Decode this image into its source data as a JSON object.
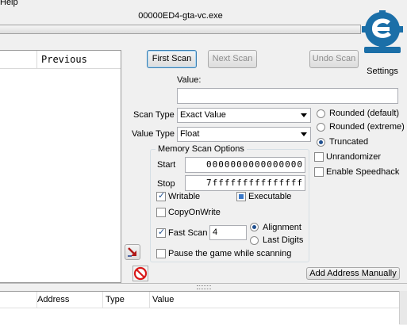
{
  "menu": {
    "help": "Help"
  },
  "process_title": "00000ED4-gta-vc.exe",
  "logo": {
    "icon": "cheat-engine-logo",
    "text": "Cheat Engine"
  },
  "settings_label": "Settings",
  "results": {
    "previous_header": "Previous"
  },
  "buttons": {
    "first_scan": "First Scan",
    "next_scan": "Next Scan",
    "undo_scan": "Undo Scan",
    "add_address_manually": "Add Address Manually"
  },
  "value": {
    "label": "Value:",
    "input": ""
  },
  "scan_type": {
    "label": "Scan Type",
    "selected": "Exact Value"
  },
  "value_type": {
    "label": "Value Type",
    "selected": "Float"
  },
  "rounding": {
    "rounded_default": "Rounded (default)",
    "rounded_extreme": "Rounded (extreme)",
    "truncated": "Truncated",
    "selected": "Truncated"
  },
  "options": {
    "unrandomizer": "Unrandomizer",
    "enable_speedhack": "Enable Speedhack"
  },
  "memory_scan": {
    "title": "Memory Scan Options",
    "start_label": "Start",
    "start_value": "0000000000000000",
    "stop_label": "Stop",
    "stop_value": "7fffffffffffffff",
    "writable": "Writable",
    "executable": "Executable",
    "copy_on_write": "CopyOnWrite",
    "fast_scan": "Fast Scan",
    "fast_scan_value": "4",
    "alignment": "Alignment",
    "last_digits": "Last Digits",
    "pause_game": "Pause the game while scanning"
  },
  "address_list": {
    "columns": [
      "Address",
      "Type",
      "Value"
    ]
  },
  "colors": {
    "accent": "#1f4f8f",
    "logo_blue": "#1b6fa8"
  }
}
